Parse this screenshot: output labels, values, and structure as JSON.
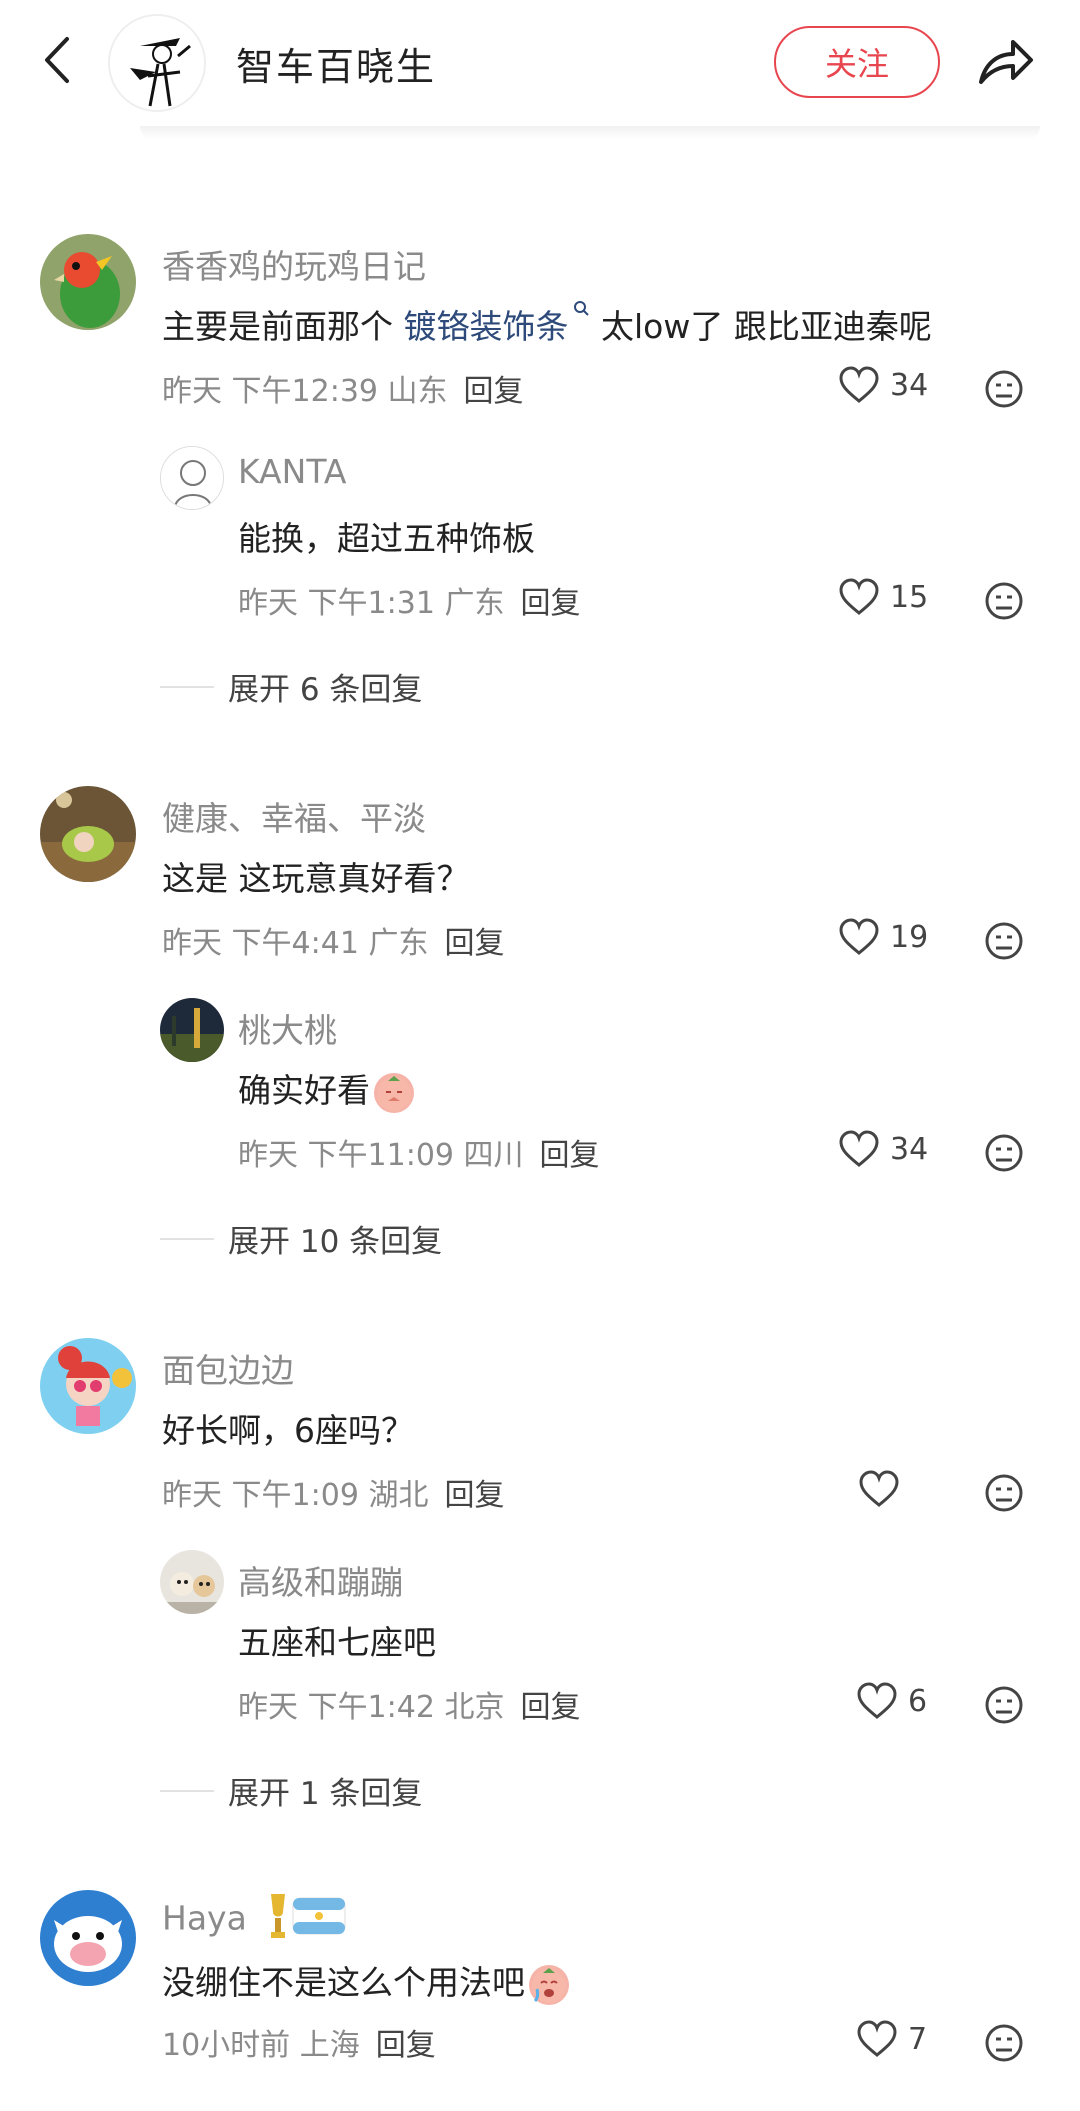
{
  "header": {
    "title": "智车百晓生",
    "follow_label": "关注"
  },
  "comments": [
    {
      "username": "香香鸡的玩鸡日记",
      "text_before": "主要是前面那个 ",
      "keyword": "镀铬装饰条",
      "text_after": " 太low了  跟比亚迪秦呢",
      "time": "昨天 下午12:39 山东",
      "reply_label": "回复",
      "likes": "34",
      "reply": {
        "username": "KANTA",
        "text": "能换，超过五种饰板",
        "time": "昨天 下午1:31 广东",
        "reply_label": "回复",
        "likes": "15"
      },
      "expand_label": "展开 6 条回复"
    },
    {
      "username": "健康、幸福、平淡",
      "text": "这是 这玩意真好看？",
      "time": "昨天 下午4:41 广东",
      "reply_label": "回复",
      "likes": "19",
      "reply": {
        "username": "桃大桃",
        "text": "确实好看",
        "time": "昨天 下午11:09 四川",
        "reply_label": "回复",
        "likes": "34"
      },
      "expand_label": "展开 10 条回复"
    },
    {
      "username": "面包边边",
      "text": "好长啊，6座吗？",
      "time": "昨天 下午1:09 湖北",
      "reply_label": "回复",
      "likes": "",
      "reply": {
        "username": "高级和蹦蹦",
        "text": "五座和七座吧",
        "time": "昨天 下午1:42 北京",
        "reply_label": "回复",
        "likes": "6"
      },
      "expand_label": "展开 1 条回复"
    },
    {
      "username": "Haya",
      "text": "没绷住不是这么个用法吧",
      "time": "10小时前 上海",
      "reply_label": "回复",
      "likes": "7"
    }
  ],
  "colors": {
    "accent": "#e8464f",
    "keyword": "#2d4a7a",
    "meta": "#8a8a8a"
  }
}
